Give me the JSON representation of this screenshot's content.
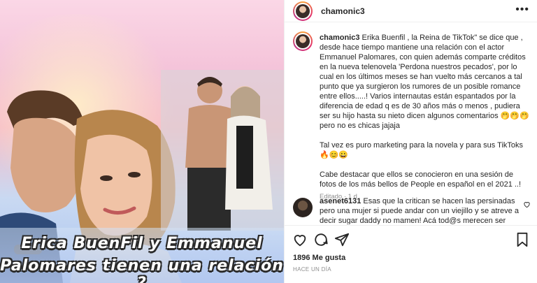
{
  "post": {
    "image_caption_line1": "Erica BuenFil y Emmanuel",
    "image_caption_line2": "Palomares tienen una relación ?"
  },
  "header": {
    "username": "chamonic3",
    "more_label": "•••"
  },
  "caption": {
    "username": "chamonic3",
    "paragraph1": "Erika Buenfil , la Reina de TikTok\" se dice que , desde hace tiempo mantiene una relación con el actor Emmanuel Palomares, con quien además comparte créditos en la nueva telenovela 'Perdona nuestros pecados', por lo cual en los últimos meses se han vuelto más cercanos a tal punto que ya surgieron los rumores de un posible romance entre ellos.....! Varios internautas están espantados por la diferencia de edad q es de 30 años más o menos , pudiera ser su hijo hasta su nieto dicen algunos comentarios 🤭🤭🤭 pero no es chicas jajaja",
    "paragraph2": "Tal vez es puro marketing para la novela y para sus TikToks 🔥😊😀",
    "paragraph3": "Cabe destacar que ellos se conocieron en una sesión de fotos de los más bellos de People en español en el 2021 ..!",
    "edited": "Editado · 1 d"
  },
  "reply": {
    "username": "asenet6131",
    "text": "Esas que la critican se hacen las persinadas pero una mujer si puede andar con un viejillo y se atreve a decir sugar daddy no mamen! Acá tod@s merecen ser felices como"
  },
  "actions": {
    "likes": "1896 Me gusta",
    "timestamp": "HACE UN DÍA"
  }
}
